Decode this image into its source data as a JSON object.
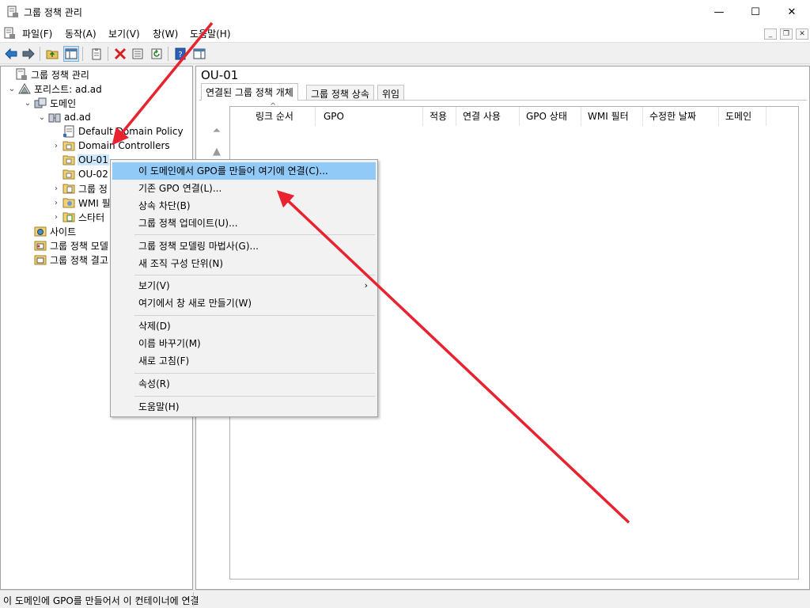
{
  "window": {
    "title": "그룹 정책 관리",
    "minimize": "—",
    "maximize": "☐",
    "close": "✕"
  },
  "menu": {
    "items": [
      "파일(F)",
      "동작(A)",
      "보기(V)",
      "창(W)",
      "도움말(H)"
    ],
    "mdi_min": "_",
    "mdi_restore": "❐",
    "mdi_close": "✕"
  },
  "tree": {
    "root": "그룹 정책 관리",
    "forest": "포리스트: ad.ad",
    "domains": "도메인",
    "domain": "ad.ad",
    "default_policy": "Default Domain Policy",
    "domain_controllers": "Domain Controllers",
    "ou01": "OU-01",
    "ou02": "OU-02",
    "gpo_objects": "그룹 정",
    "wmi_filters": "WMI 필",
    "starter_gpos": "스타터",
    "sites": "사이트",
    "modeling": "그룹 정책 모델",
    "results": "그룹 정책 결고"
  },
  "right": {
    "title": "OU-01",
    "tabs": [
      "연결된 그룹 정책 개체",
      "그룹 정책 상속",
      "위임"
    ],
    "columns": [
      "링크 순서",
      "GPO",
      "적용",
      "연결 사용",
      "GPO 상태",
      "WMI 필터",
      "수정한 날짜",
      "도메인"
    ],
    "sort_glyph": "^",
    "move_top": "⏶",
    "move_up": "▲"
  },
  "context_menu": {
    "items": [
      "이 도메인에서 GPO를 만들어 여기에 연결(C)...",
      "기존 GPO 연결(L)...",
      "상속 차단(B)",
      "그룹 정책 업데이트(U)...",
      "그룹 정책 모델링 마법사(G)...",
      "새 조직 구성 단위(N)",
      "보기(V)",
      "여기에서 창 새로 만들기(W)",
      "삭제(D)",
      "이름 바꾸기(M)",
      "새로 고침(F)",
      "속성(R)",
      "도움말(H)"
    ],
    "submenu_arrow": "›"
  },
  "status": {
    "text": "이 도메인에 GPO를 만들어서 이 컨테이너에 연결"
  },
  "colors": {
    "selection": "#cce8ff",
    "menu_highlight": "#91c9f7",
    "annotation": "#e8222e"
  }
}
